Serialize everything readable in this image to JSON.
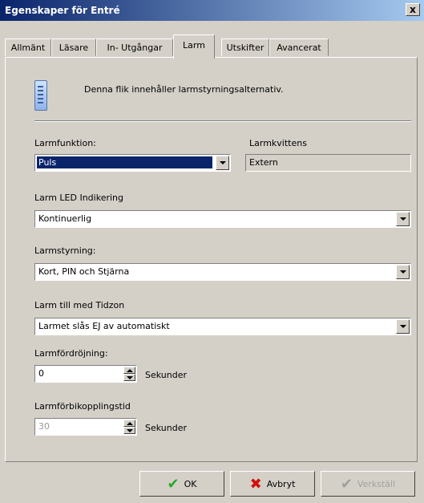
{
  "window": {
    "title": "Egenskaper för Entré",
    "close_label": "x"
  },
  "tabs": [
    {
      "label": "Allmänt"
    },
    {
      "label": "Läsare"
    },
    {
      "label": "In- Utgångar"
    },
    {
      "label": "Larm",
      "active": true
    },
    {
      "label": "Utskifter"
    },
    {
      "label": "Avancerat"
    }
  ],
  "header": {
    "icon": "panel-icon",
    "description": "Denna flik innehåller larmstyrningsalternativ."
  },
  "alarm_function": {
    "label": "Larmfunktion:",
    "value": "Puls"
  },
  "alarm_ack": {
    "label": "Larmkvittens",
    "value": "Extern"
  },
  "led": {
    "label": "Larm LED Indikering",
    "value": "Kontinuerlig"
  },
  "control": {
    "label": "Larmstyrning:",
    "value": "Kort, PIN och Stjärna"
  },
  "timezone": {
    "label": "Larm till med Tidzon",
    "value": "Larmet slås EJ av automatiskt"
  },
  "delay": {
    "label": "Larmfördröjning:",
    "value": "0",
    "unit": "Sekunder"
  },
  "bypass": {
    "label": "Larmförbikopplingstid",
    "value": "30",
    "unit": "Sekunder"
  },
  "buttons": {
    "ok": "OK",
    "cancel": "Avbryt",
    "apply": "Verkställ"
  },
  "colors": {
    "title_start": "#0a246a",
    "title_end": "#a6caf0",
    "selection": "#0a246a",
    "face": "#d4d0c8"
  }
}
